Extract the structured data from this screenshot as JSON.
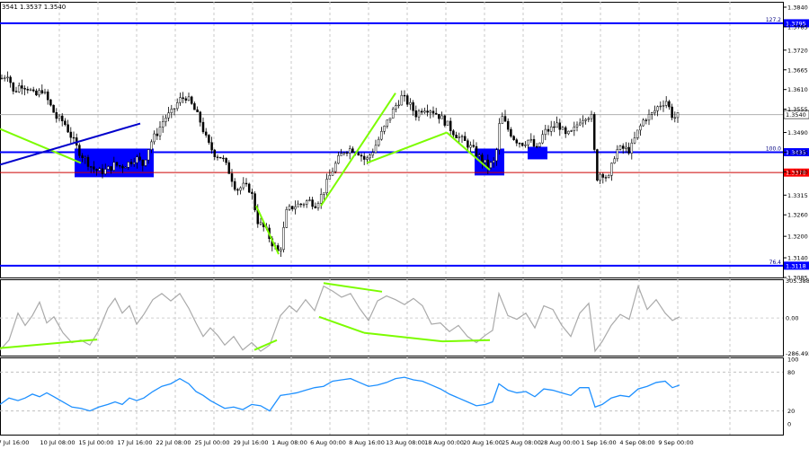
{
  "header": {
    "quote": "3541 1.3537 1.3540"
  },
  "chart_data": [
    {
      "type": "candlestick",
      "y_ticks": [
        "1.3840",
        "1.3785",
        "1.3720",
        "1.3665",
        "1.3610",
        "1.3555",
        "1.3490",
        "1.3435",
        "1.3380",
        "1.3315",
        "1.3260",
        "1.3200",
        "1.3140",
        "1.3085"
      ],
      "ylim": [
        1.3085,
        1.3855
      ],
      "x_ticks": [
        "7 Jul 16:00",
        "10 Jul 08:00",
        "15 Jul 00:00",
        "17 Jul 16:00",
        "22 Jul 08:00",
        "25 Jul 00:00",
        "29 Jul 16:00",
        "1 Aug 08:00",
        "6 Aug 00:00",
        "8 Aug 16:00",
        "13 Aug 08:00",
        "18 Aug 00:00",
        "20 Aug 16:00",
        "25 Aug 08:00",
        "28 Aug 00:00",
        "1 Sep 16:00",
        "4 Sep 08:00",
        "9 Sep 00:00"
      ],
      "close_path": [
        [
          0,
          1.364
        ],
        [
          8,
          1.3655
        ],
        [
          14,
          1.36
        ],
        [
          22,
          1.3625
        ],
        [
          30,
          1.3615
        ],
        [
          38,
          1.359
        ],
        [
          46,
          1.361
        ],
        [
          54,
          1.357
        ],
        [
          62,
          1.353
        ],
        [
          70,
          1.352
        ],
        [
          78,
          1.348
        ],
        [
          86,
          1.344
        ],
        [
          94,
          1.3415
        ],
        [
          102,
          1.339
        ],
        [
          110,
          1.338
        ],
        [
          118,
          1.3385
        ],
        [
          126,
          1.34
        ],
        [
          134,
          1.3395
        ],
        [
          142,
          1.3405
        ],
        [
          150,
          1.342
        ],
        [
          158,
          1.34
        ],
        [
          166,
          1.346
        ],
        [
          174,
          1.349
        ],
        [
          182,
          1.353
        ],
        [
          190,
          1.3545
        ],
        [
          198,
          1.358
        ],
        [
          206,
          1.359
        ],
        [
          214,
          1.356
        ],
        [
          222,
          1.352
        ],
        [
          230,
          1.346
        ],
        [
          238,
          1.343
        ],
        [
          246,
          1.342
        ],
        [
          254,
          1.338
        ],
        [
          262,
          1.333
        ],
        [
          270,
          1.334
        ],
        [
          278,
          1.333
        ],
        [
          286,
          1.324
        ],
        [
          294,
          1.322
        ],
        [
          302,
          1.318
        ],
        [
          310,
          1.315
        ],
        [
          318,
          1.327
        ],
        [
          326,
          1.3285
        ],
        [
          334,
          1.329
        ],
        [
          342,
          1.33
        ],
        [
          350,
          1.329
        ],
        [
          358,
          1.332
        ],
        [
          366,
          1.337
        ],
        [
          374,
          1.341
        ],
        [
          382,
          1.344
        ],
        [
          390,
          1.3445
        ],
        [
          398,
          1.3435
        ],
        [
          406,
          1.341
        ],
        [
          414,
          1.344
        ],
        [
          422,
          1.348
        ],
        [
          430,
          1.352
        ],
        [
          438,
          1.356
        ],
        [
          446,
          1.359
        ],
        [
          454,
          1.357
        ],
        [
          462,
          1.354
        ],
        [
          470,
          1.356
        ],
        [
          478,
          1.3555
        ],
        [
          486,
          1.354
        ],
        [
          494,
          1.352
        ],
        [
          502,
          1.3495
        ],
        [
          510,
          1.3475
        ],
        [
          518,
          1.346
        ],
        [
          526,
          1.344
        ],
        [
          534,
          1.3415
        ],
        [
          542,
          1.3395
        ],
        [
          550,
          1.341
        ],
        [
          556,
          1.354
        ],
        [
          564,
          1.35
        ],
        [
          572,
          1.347
        ],
        [
          580,
          1.346
        ],
        [
          588,
          1.347
        ],
        [
          596,
          1.344
        ],
        [
          604,
          1.349
        ],
        [
          612,
          1.35
        ],
        [
          620,
          1.3515
        ],
        [
          628,
          1.348
        ],
        [
          636,
          1.349
        ],
        [
          644,
          1.3525
        ],
        [
          652,
          1.354
        ],
        [
          658,
          1.353
        ],
        [
          662,
          1.336
        ],
        [
          668,
          1.338
        ],
        [
          676,
          1.336
        ],
        [
          684,
          1.344
        ],
        [
          692,
          1.3445
        ],
        [
          700,
          1.344
        ],
        [
          708,
          1.349
        ],
        [
          716,
          1.353
        ],
        [
          724,
          1.354
        ],
        [
          732,
          1.3565
        ],
        [
          740,
          1.358
        ],
        [
          748,
          1.353
        ],
        [
          756,
          1.354
        ]
      ],
      "levels": [
        {
          "label": "127.2",
          "value": 1.3795,
          "tag": "1.3795",
          "color": "#0000ff"
        },
        {
          "label": "100.0",
          "value": 1.3435,
          "tag": "1.3435",
          "color": "#0000ff"
        },
        {
          "label": "76.4",
          "value": 1.3118,
          "tag": "1.3118",
          "color": "#0000ff"
        }
      ],
      "red_level": {
        "value": 1.3378,
        "tag": "1.3378",
        "color": "#cc0000"
      },
      "current_price": {
        "value": 1.354,
        "tag": "1.3540"
      },
      "zones": [
        {
          "x0": 83,
          "x1": 171,
          "y0": 1.3445,
          "y1": 1.3365
        },
        {
          "x0": 528,
          "x1": 561,
          "y0": 1.3445,
          "y1": 1.337
        },
        {
          "x0": 587,
          "x1": 609,
          "y0": 1.345,
          "y1": 1.3415
        }
      ],
      "green_lines": [
        {
          "x0": 0,
          "y0": 1.35,
          "x1": 90,
          "y1": 1.3405
        },
        {
          "x0": 285,
          "y0": 1.3285,
          "x1": 310,
          "y1": 1.315
        },
        {
          "x0": 357,
          "y0": 1.3285,
          "x1": 440,
          "y1": 1.36
        },
        {
          "x0": 408,
          "y0": 1.3405,
          "x1": 497,
          "y1": 1.349
        },
        {
          "x0": 497,
          "y0": 1.349,
          "x1": 545,
          "y1": 1.3385
        }
      ],
      "blue_trendline": {
        "x0": 0,
        "y0": 1.34,
        "x1": 156,
        "y1": 1.3515,
        "color": "#0000cc"
      }
    },
    {
      "type": "line",
      "name": "cci",
      "ticks": [
        "305.3888",
        "0.00",
        "-286.493"
      ],
      "ylim": [
        -306,
        316
      ],
      "series": [
        [
          0,
          -260
        ],
        [
          10,
          -180
        ],
        [
          20,
          40
        ],
        [
          28,
          -60
        ],
        [
          36,
          20
        ],
        [
          44,
          130
        ],
        [
          52,
          -40
        ],
        [
          60,
          10
        ],
        [
          70,
          -120
        ],
        [
          80,
          -200
        ],
        [
          90,
          -180
        ],
        [
          100,
          -220
        ],
        [
          110,
          -100
        ],
        [
          120,
          80
        ],
        [
          128,
          160
        ],
        [
          136,
          40
        ],
        [
          144,
          100
        ],
        [
          152,
          -50
        ],
        [
          160,
          30
        ],
        [
          170,
          150
        ],
        [
          180,
          200
        ],
        [
          190,
          140
        ],
        [
          200,
          200
        ],
        [
          210,
          80
        ],
        [
          218,
          -40
        ],
        [
          226,
          -150
        ],
        [
          234,
          -80
        ],
        [
          242,
          -140
        ],
        [
          250,
          -220
        ],
        [
          260,
          -150
        ],
        [
          270,
          -260
        ],
        [
          280,
          -200
        ],
        [
          290,
          -270
        ],
        [
          300,
          -220
        ],
        [
          312,
          20
        ],
        [
          322,
          100
        ],
        [
          330,
          50
        ],
        [
          340,
          150
        ],
        [
          350,
          60
        ],
        [
          360,
          260
        ],
        [
          370,
          220
        ],
        [
          380,
          170
        ],
        [
          390,
          200
        ],
        [
          400,
          80
        ],
        [
          410,
          -20
        ],
        [
          420,
          140
        ],
        [
          430,
          180
        ],
        [
          440,
          150
        ],
        [
          450,
          110
        ],
        [
          460,
          160
        ],
        [
          470,
          100
        ],
        [
          480,
          -50
        ],
        [
          490,
          -40
        ],
        [
          500,
          -110
        ],
        [
          510,
          -60
        ],
        [
          520,
          -150
        ],
        [
          530,
          -200
        ],
        [
          540,
          -140
        ],
        [
          548,
          -100
        ],
        [
          555,
          200
        ],
        [
          565,
          20
        ],
        [
          575,
          -10
        ],
        [
          585,
          40
        ],
        [
          595,
          -80
        ],
        [
          605,
          100
        ],
        [
          615,
          70
        ],
        [
          625,
          -60
        ],
        [
          635,
          -150
        ],
        [
          645,
          40
        ],
        [
          655,
          120
        ],
        [
          662,
          -270
        ],
        [
          670,
          -190
        ],
        [
          680,
          -60
        ],
        [
          690,
          30
        ],
        [
          700,
          -10
        ],
        [
          710,
          260
        ],
        [
          720,
          70
        ],
        [
          730,
          150
        ],
        [
          740,
          40
        ],
        [
          748,
          -20
        ],
        [
          756,
          10
        ]
      ],
      "green_lines": [
        {
          "x0": 0,
          "y0": -245,
          "x1": 108,
          "y1": -175
        },
        {
          "x0": 283,
          "y0": -260,
          "x1": 308,
          "y1": -180
        },
        {
          "x0": 360,
          "y0": 285,
          "x1": 425,
          "y1": 215
        },
        {
          "x0": 355,
          "y0": 10,
          "x1": 405,
          "y1": -120
        },
        {
          "x0": 405,
          "y0": -120,
          "x1": 492,
          "y1": -190
        },
        {
          "x0": 492,
          "y0": -190,
          "x1": 545,
          "y1": -180
        }
      ]
    },
    {
      "type": "line",
      "name": "rsi",
      "ticks": [
        "100",
        "80",
        "20",
        "0"
      ],
      "ylim": [
        0,
        100
      ],
      "series": [
        [
          0,
          30
        ],
        [
          10,
          40
        ],
        [
          20,
          36
        ],
        [
          28,
          40
        ],
        [
          36,
          46
        ],
        [
          44,
          42
        ],
        [
          52,
          48
        ],
        [
          60,
          42
        ],
        [
          70,
          34
        ],
        [
          80,
          26
        ],
        [
          90,
          24
        ],
        [
          100,
          20
        ],
        [
          110,
          26
        ],
        [
          120,
          30
        ],
        [
          128,
          34
        ],
        [
          136,
          30
        ],
        [
          144,
          40
        ],
        [
          152,
          36
        ],
        [
          160,
          40
        ],
        [
          170,
          50
        ],
        [
          180,
          58
        ],
        [
          190,
          62
        ],
        [
          200,
          70
        ],
        [
          210,
          62
        ],
        [
          218,
          50
        ],
        [
          226,
          44
        ],
        [
          234,
          36
        ],
        [
          242,
          30
        ],
        [
          250,
          24
        ],
        [
          260,
          26
        ],
        [
          270,
          22
        ],
        [
          280,
          30
        ],
        [
          290,
          28
        ],
        [
          300,
          20
        ],
        [
          312,
          44
        ],
        [
          322,
          46
        ],
        [
          330,
          48
        ],
        [
          340,
          52
        ],
        [
          350,
          56
        ],
        [
          360,
          58
        ],
        [
          370,
          66
        ],
        [
          380,
          68
        ],
        [
          390,
          70
        ],
        [
          400,
          64
        ],
        [
          410,
          58
        ],
        [
          420,
          60
        ],
        [
          430,
          64
        ],
        [
          440,
          70
        ],
        [
          450,
          72
        ],
        [
          460,
          68
        ],
        [
          470,
          66
        ],
        [
          480,
          60
        ],
        [
          490,
          54
        ],
        [
          500,
          46
        ],
        [
          510,
          40
        ],
        [
          520,
          34
        ],
        [
          530,
          28
        ],
        [
          540,
          30
        ],
        [
          548,
          34
        ],
        [
          555,
          62
        ],
        [
          565,
          52
        ],
        [
          575,
          48
        ],
        [
          585,
          50
        ],
        [
          595,
          42
        ],
        [
          605,
          54
        ],
        [
          615,
          52
        ],
        [
          625,
          48
        ],
        [
          635,
          44
        ],
        [
          645,
          56
        ],
        [
          655,
          56
        ],
        [
          662,
          26
        ],
        [
          670,
          30
        ],
        [
          680,
          40
        ],
        [
          690,
          44
        ],
        [
          700,
          42
        ],
        [
          710,
          54
        ],
        [
          720,
          58
        ],
        [
          730,
          64
        ],
        [
          740,
          66
        ],
        [
          748,
          56
        ],
        [
          756,
          60
        ]
      ]
    }
  ]
}
